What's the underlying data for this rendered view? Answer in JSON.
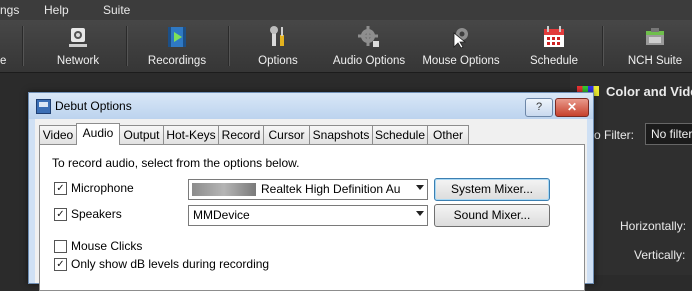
{
  "menubar": {
    "item1": "ngs",
    "item2": "Help",
    "item3": "Suite"
  },
  "toolbar": {
    "items": [
      {
        "label": "e"
      },
      {
        "label": "Network"
      },
      {
        "label": "Recordings"
      },
      {
        "label": "Options"
      },
      {
        "label": "Audio Options"
      },
      {
        "label": "Mouse Options"
      },
      {
        "label": "Schedule"
      },
      {
        "label": "NCH Suite"
      }
    ]
  },
  "right_panel": {
    "title": "Color and Vide",
    "filter_label": "o Filter:",
    "filter_value": "No filter",
    "horizontally_label": "Horizontally:",
    "vertically_label": "Vertically:"
  },
  "dialog": {
    "title": "Debut Options",
    "help_label": "?",
    "close_label": "✕",
    "tabs": [
      "Video",
      "Audio",
      "Output",
      "Hot-Keys",
      "Record",
      "Cursor",
      "Snapshots",
      "Schedule",
      "Other"
    ],
    "active_tab": "Audio",
    "intro": "To record audio, select from the options below.",
    "microphone": {
      "label": "Microphone",
      "checked": "✓",
      "device": "Realtek High Definition Au",
      "button": "System Mixer..."
    },
    "speakers": {
      "label": "Speakers",
      "checked": "✓",
      "device": "MMDevice",
      "button": "Sound Mixer..."
    },
    "mouse_clicks": {
      "label": "Mouse Clicks"
    },
    "db_levels": {
      "label": "Only show dB levels during recording",
      "checked": "✓"
    }
  },
  "colors": {
    "toolbar_bg": "#3e3e3e",
    "dialog_frame": "#cfe0f4",
    "close_red": "#c7412c"
  }
}
